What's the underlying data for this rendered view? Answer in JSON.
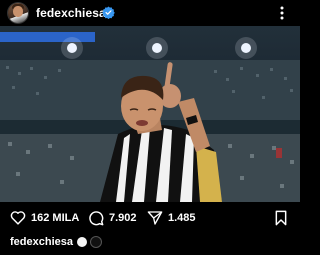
{
  "header": {
    "username": "fedexchiesa",
    "verified": true,
    "avatar_icon": "profile-avatar",
    "more_icon": "more-vertical-icon"
  },
  "post": {
    "image_icon": "post-photo"
  },
  "actions": {
    "likes": "162 MILA",
    "comments": "7.902",
    "shares": "1.485",
    "like_icon": "heart-icon",
    "comment_icon": "comment-icon",
    "share_icon": "send-icon",
    "save_icon": "bookmark-icon"
  },
  "caption": {
    "username": "fedexchiesa",
    "emoji": [
      "white-circle",
      "black-circle"
    ]
  },
  "colors": {
    "background": "#000000",
    "text": "#ffffff",
    "verified": "#3897f0",
    "jersey_black": "#111111",
    "jersey_white": "#f2f2f2",
    "jersey_gold": "#d4b24c"
  }
}
